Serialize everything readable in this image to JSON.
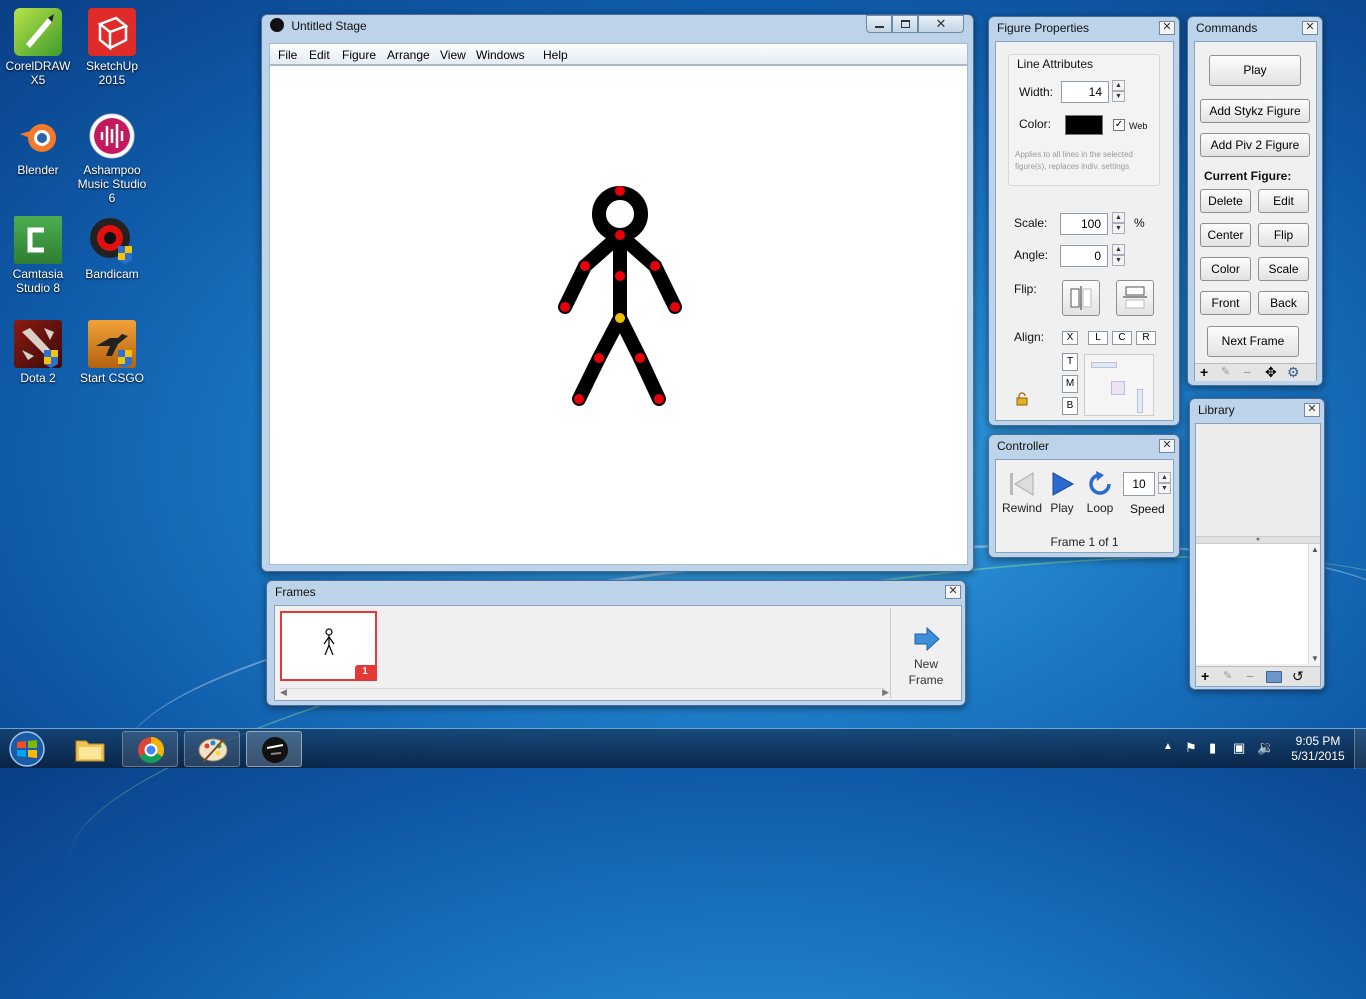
{
  "desktop_icons": [
    {
      "label": "CorelDRAW X5",
      "icon": "coreldraw-icon"
    },
    {
      "label": "SketchUp 2015",
      "icon": "sketchup-icon"
    },
    {
      "label": "Blender",
      "icon": "blender-icon"
    },
    {
      "label": "Ashampoo Music Studio 6",
      "icon": "ashampoo-icon"
    },
    {
      "label": "Camtasia Studio 8",
      "icon": "camtasia-icon"
    },
    {
      "label": "Bandicam",
      "icon": "bandicam-icon"
    },
    {
      "label": "Dota 2",
      "icon": "dota2-icon"
    },
    {
      "label": "Start CSGO",
      "icon": "csgo-icon"
    }
  ],
  "stage": {
    "title": "Untitled Stage",
    "menu": [
      "File",
      "Edit",
      "Figure",
      "Arrange",
      "View",
      "Windows",
      "Help"
    ]
  },
  "frames": {
    "title": "Frames",
    "frame_number": "1",
    "new_frame_label": "New Frame"
  },
  "figure_properties": {
    "title": "Figure Properties",
    "line_attributes": "Line Attributes",
    "width_label": "Width:",
    "width_value": "14",
    "color_label": "Color:",
    "color_value": "#000000",
    "web_label": "Web",
    "note": "Applies to all lines in the selected figure(s), replaces indiv. settings",
    "scale_label": "Scale:",
    "scale_value": "100",
    "scale_unit": "%",
    "angle_label": "Angle:",
    "angle_value": "0",
    "flip_label": "Flip:",
    "align_label": "Align:",
    "align_x": "X",
    "align_l": "L",
    "align_c": "C",
    "align_r": "R",
    "align_t": "T",
    "align_m": "M",
    "align_b": "B"
  },
  "commands": {
    "title": "Commands",
    "play": "Play",
    "add_stykz": "Add Stykz Figure",
    "add_piv": "Add Piv 2 Figure",
    "current_figure": "Current Figure:",
    "delete": "Delete",
    "edit": "Edit",
    "center": "Center",
    "flip": "Flip",
    "color": "Color",
    "scale": "Scale",
    "front": "Front",
    "back": "Back",
    "next_frame": "Next Frame"
  },
  "controller": {
    "title": "Controller",
    "rewind": "Rewind",
    "play": "Play",
    "loop": "Loop",
    "speed_label": "Speed",
    "speed_value": "10",
    "frame_status": "Frame 1 of 1"
  },
  "library": {
    "title": "Library"
  },
  "tray": {
    "time": "9:05 PM",
    "date": "5/31/2015"
  },
  "colors": {
    "joint": "#e8000b",
    "origin_joint": "#f0c000",
    "window_frame": "#bcd3ea",
    "frame_highlight": "#e53935"
  }
}
